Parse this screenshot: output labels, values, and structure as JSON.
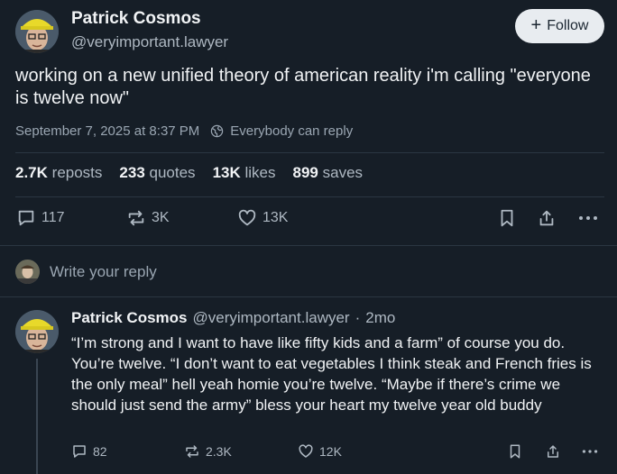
{
  "post": {
    "author_name": "Patrick Cosmos",
    "author_handle": "@veryimportant.lawyer",
    "follow_label": "Follow",
    "text": "working on a new unified theory of american reality i'm calling \"everyone is twelve now\"",
    "date": "September 7, 2025 at 8:37 PM",
    "reply_setting": "Everybody can reply",
    "stats": {
      "reposts_count": "2.7K",
      "reposts_label": "reposts",
      "quotes_count": "233",
      "quotes_label": "quotes",
      "likes_count": "13K",
      "likes_label": "likes",
      "saves_count": "899",
      "saves_label": "saves"
    },
    "actions": {
      "replies": "117",
      "reposts": "3K",
      "likes": "13K"
    }
  },
  "reply_box": {
    "placeholder": "Write your reply"
  },
  "reply": {
    "author_name": "Patrick Cosmos",
    "author_handle": "@veryimportant.lawyer",
    "separator": "·",
    "age": "2mo",
    "text": "“I’m strong and I want to have like fifty kids and a farm” of course you do. You’re twelve. “I don’t want to eat vegetables I think steak and French fries is the only meal” hell yeah homie you’re twelve. “Maybe if there’s crime we should just send the army” bless your heart my twelve year old buddy",
    "actions": {
      "replies": "82",
      "reposts": "2.3K",
      "likes": "12K"
    }
  },
  "colors": {
    "background": "#161e27",
    "text": "#f1f3f5",
    "muted": "#aeb8c2",
    "divider": "#2b3642",
    "follow_bg": "#e8ecf0"
  },
  "icons": [
    "reply-icon",
    "repost-icon",
    "like-icon",
    "bookmark-icon",
    "share-icon",
    "more-icon",
    "globe-icon",
    "plus-icon"
  ]
}
